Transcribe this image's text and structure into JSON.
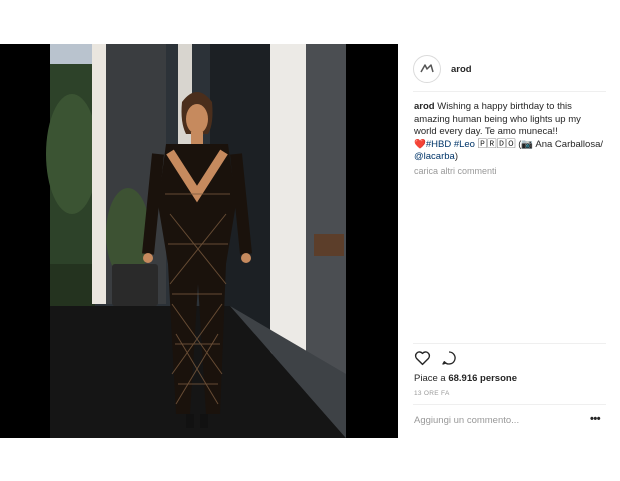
{
  "post": {
    "username": "arod",
    "caption": {
      "username": "arod",
      "text_1": "Wishing a happy birthday to this amazing human being who lights up my world every day. Te amo muneca!!",
      "heart": "❤️",
      "tags": "#HBD #Leo",
      "tag_emoji": "🄿🅁🄳🄾",
      "camera": "(📷",
      "credit_name": "Ana Carballosa/",
      "credit_handle": "@lacarba",
      "close": ")"
    },
    "load_more": "carica altri commenti",
    "likes_prefix": "Piace a",
    "likes_count": "68.916 persone",
    "time_ago": "13 ORE FA",
    "comment_placeholder": "Aggiungi un commento...",
    "options_label": "•••",
    "icons": [
      "logo-icon",
      "heart-icon",
      "comment-icon",
      "more-options-icon"
    ]
  }
}
